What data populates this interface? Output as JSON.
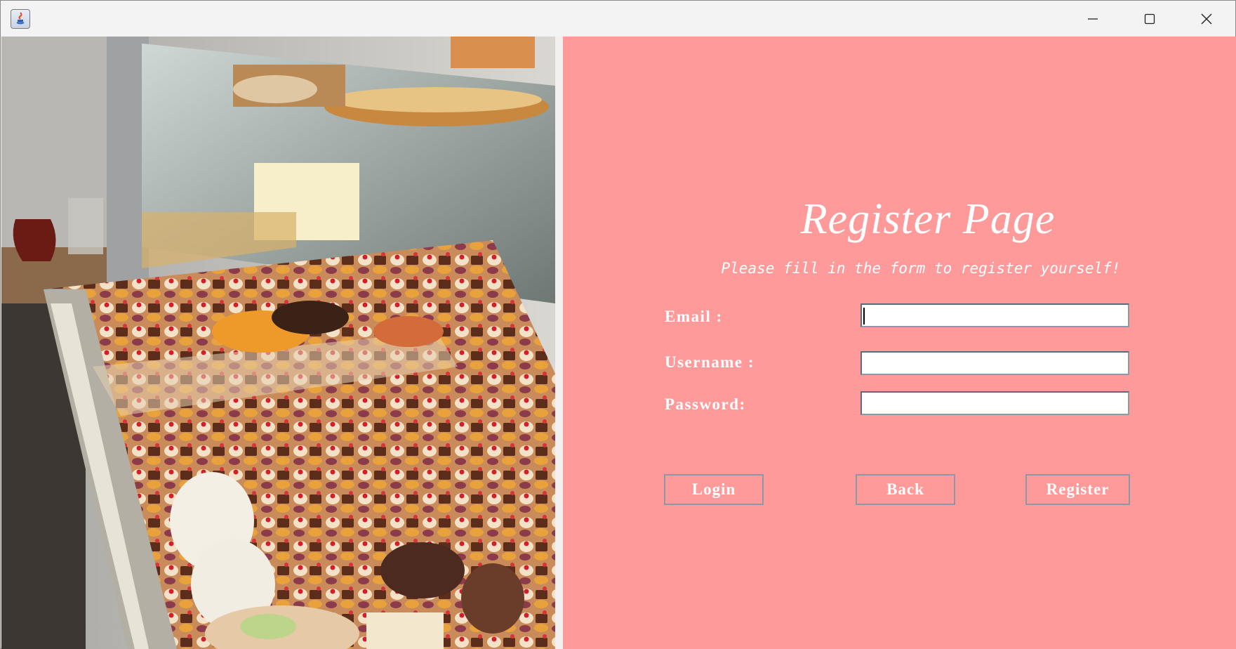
{
  "window": {
    "controls": {
      "minimize_icon": "minimize-icon",
      "maximize_icon": "maximize-icon",
      "close_icon": "close-icon"
    }
  },
  "form": {
    "title": "Register Page",
    "subtitle": "Please fill in the form to register yourself!",
    "email_label": "Email :",
    "email_value": "",
    "username_label": "Username :",
    "username_value": "",
    "password_label": "Password:",
    "password_value": ""
  },
  "buttons": {
    "login": "Login",
    "back": "Back",
    "register": "Register"
  },
  "colors": {
    "panel_background": "#ff9a9b",
    "text": "#ffffff",
    "button_border": "#8d97a6"
  }
}
